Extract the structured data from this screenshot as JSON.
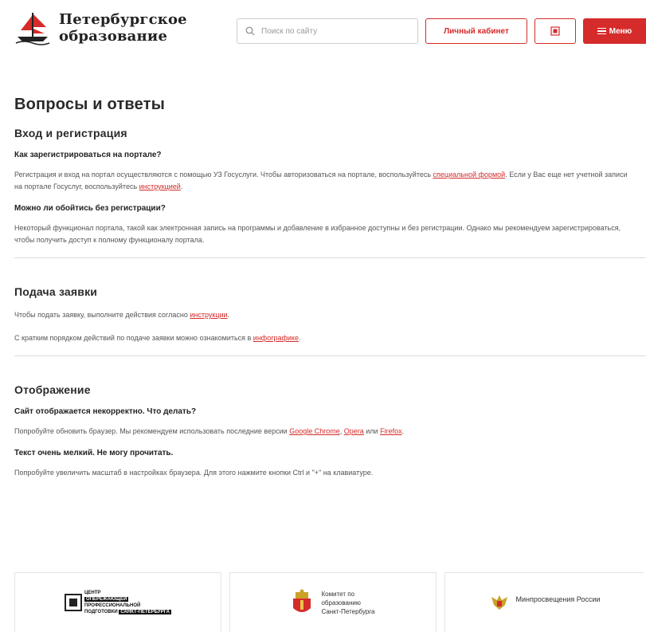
{
  "header": {
    "logo_line1": "Петербургское",
    "logo_line2": "образование",
    "search_placeholder": "Поиск по сайту",
    "cabinet_label": "Личный кабинет",
    "menu_label": "Меню"
  },
  "page": {
    "title": "Вопросы и ответы"
  },
  "sections": [
    {
      "title": "Вход и регистрация",
      "items": [
        {
          "question": "Как зарегистрироваться на портале?",
          "answer_pre": "Регистрация и вход на портал осуществляются с помощью УЗ Госуслуги. Чтобы авторизоваться на портале, воспользуйтесь ",
          "link1": "специальной формой",
          "answer_mid": ". Если у Вас еще нет учетной записи на портале Госуслуг, воспользуйтесь ",
          "link2": "инструкцией",
          "answer_post": "."
        },
        {
          "question": "Можно ли обойтись без регистрации?",
          "answer": "Некоторый функционал портала, такой как электронная запись на программы и добавление в избранное доступны и без регистрации. Однако мы рекомендуем зарегистрироваться, чтобы получить доступ к полному функционалу портала."
        }
      ]
    },
    {
      "title": "Подача заявки",
      "items": [
        {
          "answer_pre": "Чтобы подать заявку, выполните действия согласно ",
          "link1": "инструкции",
          "answer_post": "."
        },
        {
          "answer_pre": "С кратким порядком действий по подаче заявки можно ознакомиться в ",
          "link1": "инфографике",
          "answer_post": "."
        }
      ]
    },
    {
      "title": "Отображение",
      "items": [
        {
          "question": "Сайт отображается некорректно. Что делать?",
          "answer_pre": "Попробуйте обновить браузер. Мы рекомендуем использовать последние версии ",
          "link1": "Google Chrome",
          "sep1": ", ",
          "link2": "Opera",
          "sep2": " или ",
          "link3": "Firefox",
          "answer_post": "."
        },
        {
          "question": "Текст очень мелкий. Не могу прочитать.",
          "answer": "Попробуйте увеличить масштаб в настройках браузера. Для этого нажмите кнопки Ctrl и \"+\" на клавиатуре."
        }
      ]
    }
  ],
  "partners": {
    "p1_line1": "ЦЕНТР",
    "p1_line2": "ОПЕРЕЖАЮЩЕЙ",
    "p1_line3": "ПРОФЕССИОНАЛЬНОЙ",
    "p1_line4": "ПОДГОТОВКИ",
    "p1_line5": "САНКТ-ПЕТЕРБУРГА",
    "p2_line1": "Комитет по",
    "p2_line2": "образованию",
    "p2_line3": "Санкт-Петербурга",
    "p3_title": "Минпросвещения России"
  },
  "colors": {
    "accent": "#d52b2b"
  }
}
